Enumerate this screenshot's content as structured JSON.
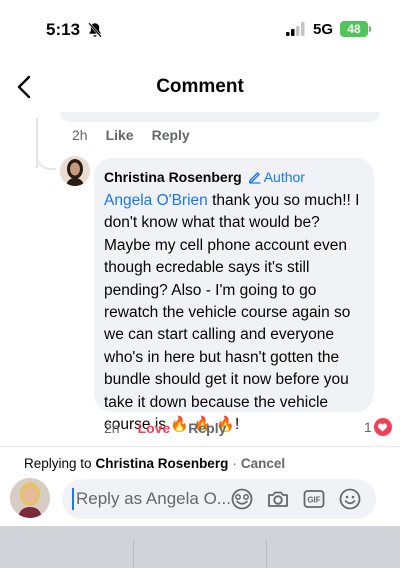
{
  "status_bar": {
    "time": "5:13",
    "network": "5G",
    "battery": "48"
  },
  "header": {
    "title": "Comment"
  },
  "previous_comment": {
    "time": "2h",
    "like_label": "Like",
    "reply_label": "Reply"
  },
  "comment": {
    "author_name": "Christina Rosenberg",
    "author_badge": "Author",
    "mention": "Angela O'Brien",
    "body": " thank you so much!! I don't know what that would be? Maybe my cell phone account even though ecredable says it's still pending? Also - I'm going to go rewatch the vehicle course again so we can start calling and everyone who's in here but hasn't gotten the bundle should get it now before you take it down because the vehicle course is ",
    "emoji": "🔥",
    "ending": "!",
    "time": "2h",
    "love_label": "Love",
    "reply_label": "Reply",
    "reaction_count": "1"
  },
  "composer": {
    "replying_prefix": "Replying to",
    "replying_to": "Christina Rosenberg",
    "separator": "·",
    "cancel_label": "Cancel",
    "placeholder": "Reply as Angela O..."
  },
  "colors": {
    "accent": "#1877f2",
    "love": "#f33e58",
    "bubble": "#f0f2f5",
    "battery": "#52c55a"
  },
  "icons": [
    "bell-slash-icon",
    "signal-icon",
    "back-chevron-icon",
    "pencil-icon",
    "heart-icon",
    "avatar-icon",
    "sticker-icon",
    "camera-icon",
    "gif-icon",
    "emoji-icon"
  ]
}
